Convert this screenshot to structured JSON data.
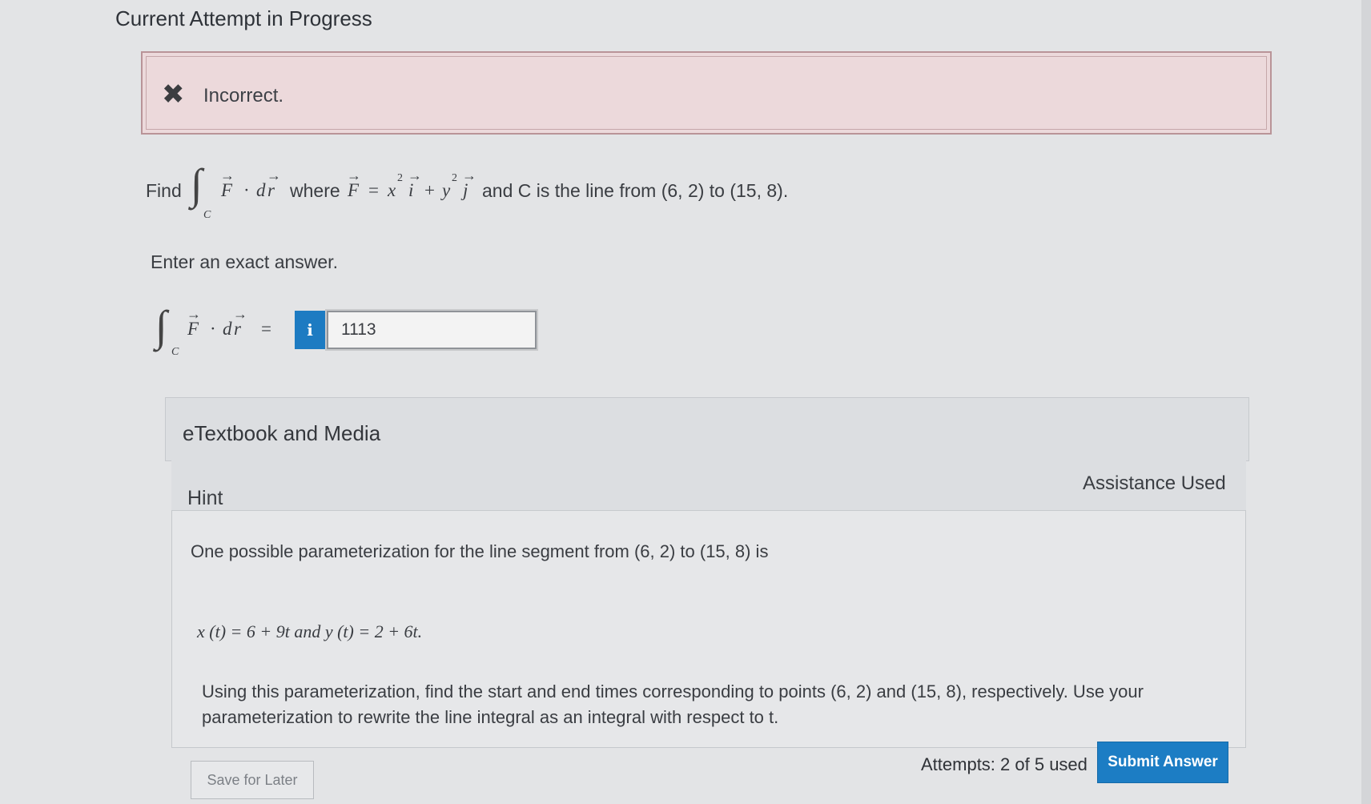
{
  "header": {
    "title": "Current Attempt in Progress"
  },
  "feedback": {
    "icon": "close-x-icon",
    "text": "Incorrect."
  },
  "question": {
    "find": "Find",
    "sub_c": "C",
    "F": "F",
    "dot": "·",
    "d": "d",
    "r": "r",
    "where": "where",
    "eq": "=",
    "x2": "x",
    "sup2a": "2",
    "i": "i",
    "plus": "+",
    "y2": "y",
    "sup2b": "2",
    "j": "j",
    "tail": "and C is the line from (6, 2) to (15, 8)."
  },
  "instruction": "Enter an exact answer.",
  "answer": {
    "lhs_sub": "C",
    "lhs_F": "F",
    "lhs_dot": "·",
    "lhs_d": "d",
    "lhs_r": "r",
    "lhs_eq": "=",
    "info_icon": "i",
    "value": "1113"
  },
  "etextbook": {
    "title": "eTextbook and Media"
  },
  "hint": {
    "title": "Hint",
    "assistance": "Assistance Used",
    "body": "One possible parameterization for the line segment from (6, 2) to (15, 8) is",
    "param": "x (t) = 6 + 9t and y (t) = 2 + 6t.",
    "more": "Using this parameterization, find the start and end times corresponding to points (6, 2) and (15, 8), respectively. Use your parameterization to rewrite the line integral as an integral with respect to t."
  },
  "footer": {
    "save_label": "Save for Later",
    "attempts": "Attempts: 2 of 5 used",
    "submit_label": "Submit Answer"
  }
}
